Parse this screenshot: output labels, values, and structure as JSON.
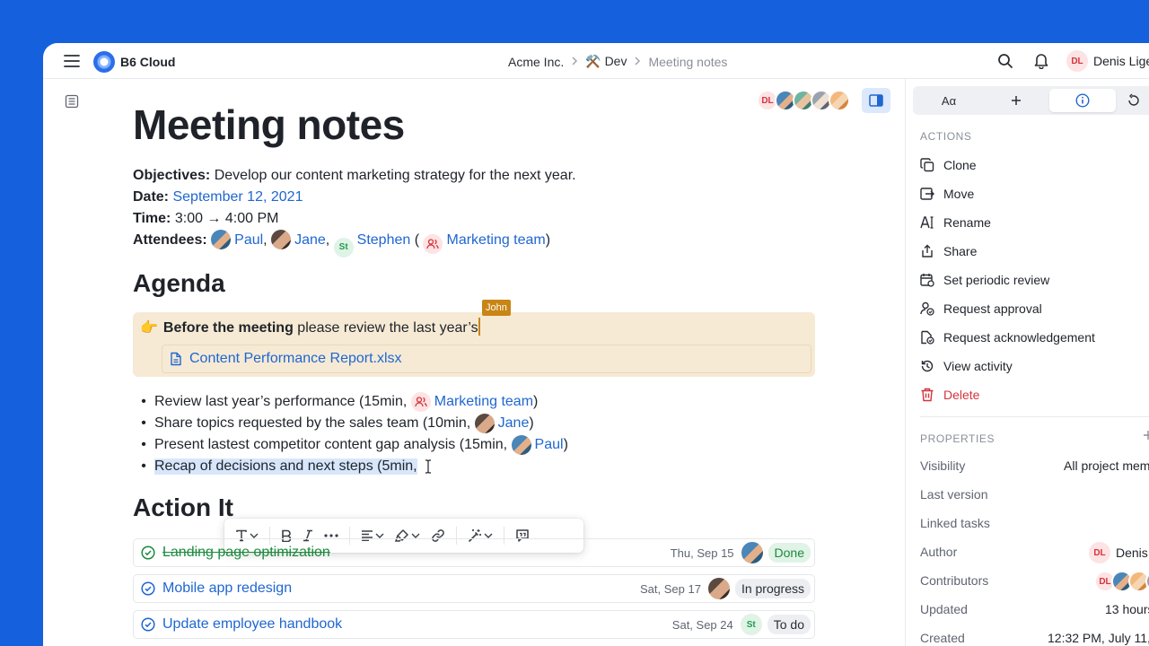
{
  "app": {
    "name": "B6 Cloud"
  },
  "breadcrumb": {
    "org": "Acme Inc.",
    "space": "⚒️ Dev",
    "page": "Meeting notes"
  },
  "user": {
    "initials": "DL",
    "name": "Denis Lige"
  },
  "doc": {
    "title": "Meeting notes",
    "objectives_label": "Objectives:",
    "objectives": " Develop our content marketing strategy for the next year.",
    "date_label": "Date:",
    "date": "September 12, 2021",
    "time_label": "Time:",
    "time": "3:00 → 4:00 PM",
    "attendees_label": "Attendees:",
    "attendees": [
      {
        "name": "Paul"
      },
      {
        "name": "Jane"
      },
      {
        "name": "Stephen",
        "initials": "St"
      }
    ],
    "team": "Marketing team",
    "presence": {
      "initials": "DL"
    }
  },
  "agenda": {
    "heading": "Agenda",
    "callout_emoji": "👉",
    "callout_bold": "Before the meeting",
    "callout_text": "please review the last year’s",
    "cursor_user": "John",
    "file": "Content Performance Report.xlsx",
    "items": [
      {
        "text": "Review last year’s performance (15min,",
        "mention": "Marketing team",
        "end": ")"
      },
      {
        "text": "Share topics requested by the sales team (10min,",
        "mention": "Jane",
        "end": ")"
      },
      {
        "text": "Present lastest competitor content gap analysis (15min,",
        "mention": "Paul",
        "end": ")"
      },
      {
        "text": "Recap of decisions and next steps (5min,",
        "mention": "",
        "end": ""
      }
    ]
  },
  "action_items": {
    "heading": "Action It",
    "tasks": [
      {
        "title": "Landing page optimization",
        "due": "Thu, Sep 15",
        "status": "Done",
        "done": true
      },
      {
        "title": "Mobile app redesign",
        "due": "Sat, Sep 17",
        "status": "In progress",
        "done": false
      },
      {
        "title": "Update employee handbook",
        "due": "Sat, Sep 24",
        "assignee_initials": "St",
        "status": "To do",
        "done": false
      }
    ]
  },
  "panel": {
    "tabs": [
      "Aα",
      "+",
      "i",
      ""
    ],
    "actions_heading": "ACTIONS",
    "actions": [
      "Clone",
      "Move",
      "Rename",
      "Share",
      "Set periodic review",
      "Request approval",
      "Request acknowledgement",
      "View activity",
      "Delete"
    ],
    "properties_heading": "PROPERTIES",
    "properties": {
      "visibility_label": "Visibility",
      "visibility": "All project mem",
      "last_version_label": "Last version",
      "linked_tasks_label": "Linked tasks",
      "author_label": "Author",
      "author": "Denis",
      "author_initials": "DL",
      "contributors_label": "Contributors",
      "contributor_initials": "DL",
      "updated_label": "Updated",
      "updated": "13 hours",
      "created_label": "Created",
      "created": "12:32 PM, July 11,"
    }
  },
  "colors": {
    "background": "#1560dc",
    "accent": "#1f66d1",
    "danger": "#d4343e",
    "callout": "#f6ead5",
    "done": "#1b8a3d"
  }
}
